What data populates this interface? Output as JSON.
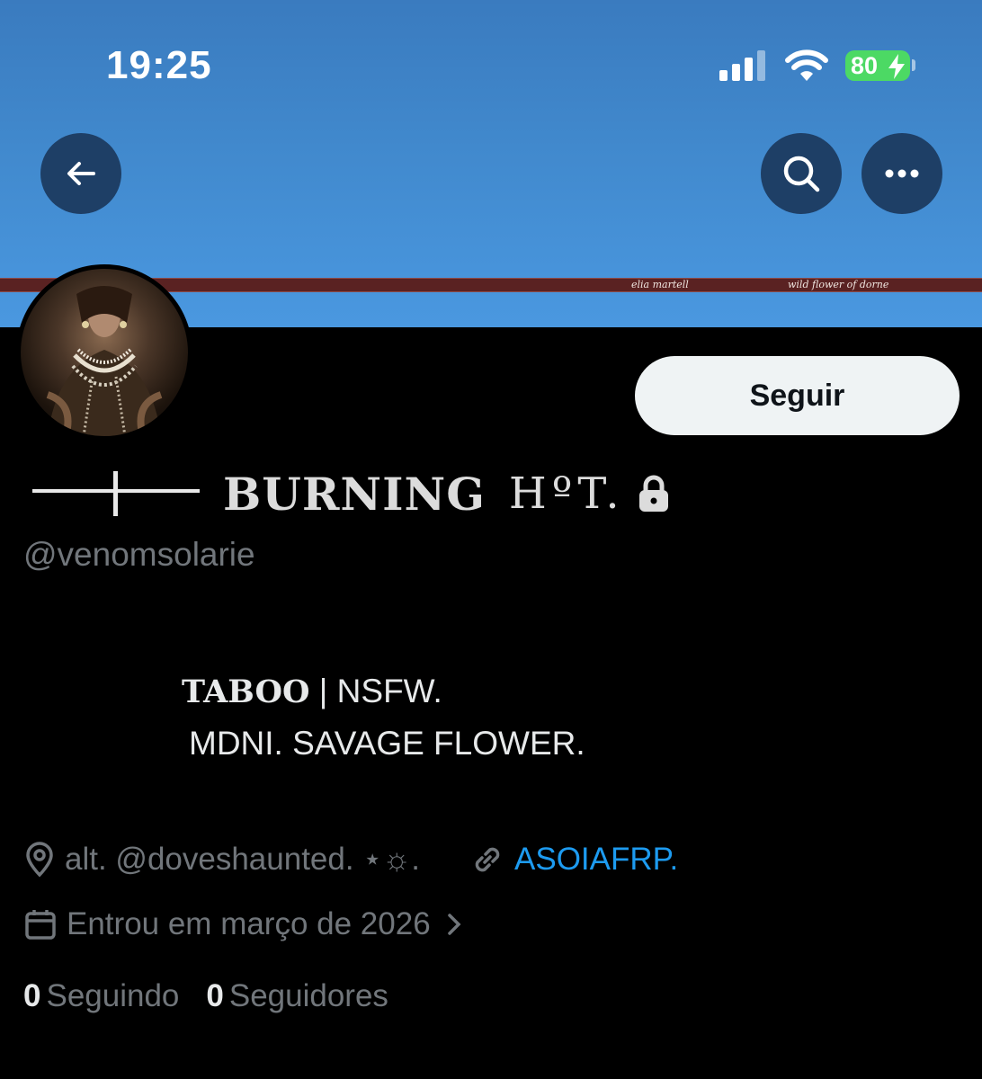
{
  "status_bar": {
    "time": "19:25",
    "battery": "80"
  },
  "banner": {
    "strip_text_left": "elia martell",
    "strip_text_right": "wild flower of dorne",
    "colors": {
      "sky": "#4189cd",
      "strip": "#5a2222"
    }
  },
  "header": {
    "back_icon": "arrow-left-icon",
    "search_icon": "search-icon",
    "more_icon": "more-horizontal-icon"
  },
  "profile": {
    "follow_label": "Seguir",
    "display_name_a": "BURNING",
    "display_name_b": "HºT.",
    "handle": "@venomsolarie",
    "bio_line1_bold": "TABOO",
    "bio_line1_rest": " | NSFW.",
    "bio_line2": "MDNI. SAVAGE FLOWER.",
    "location": "alt. @doveshaunted. ⋆☼.",
    "link": "ASOIAFRP.",
    "joined": "Entrou em março de 2026"
  },
  "stats": {
    "following_count": "0",
    "following_label": "Seguindo",
    "followers_count": "0",
    "followers_label": "Seguidores"
  },
  "colors": {
    "accent_link": "#1d9bf0",
    "muted": "#71767b",
    "battery_green": "#4cd964"
  }
}
